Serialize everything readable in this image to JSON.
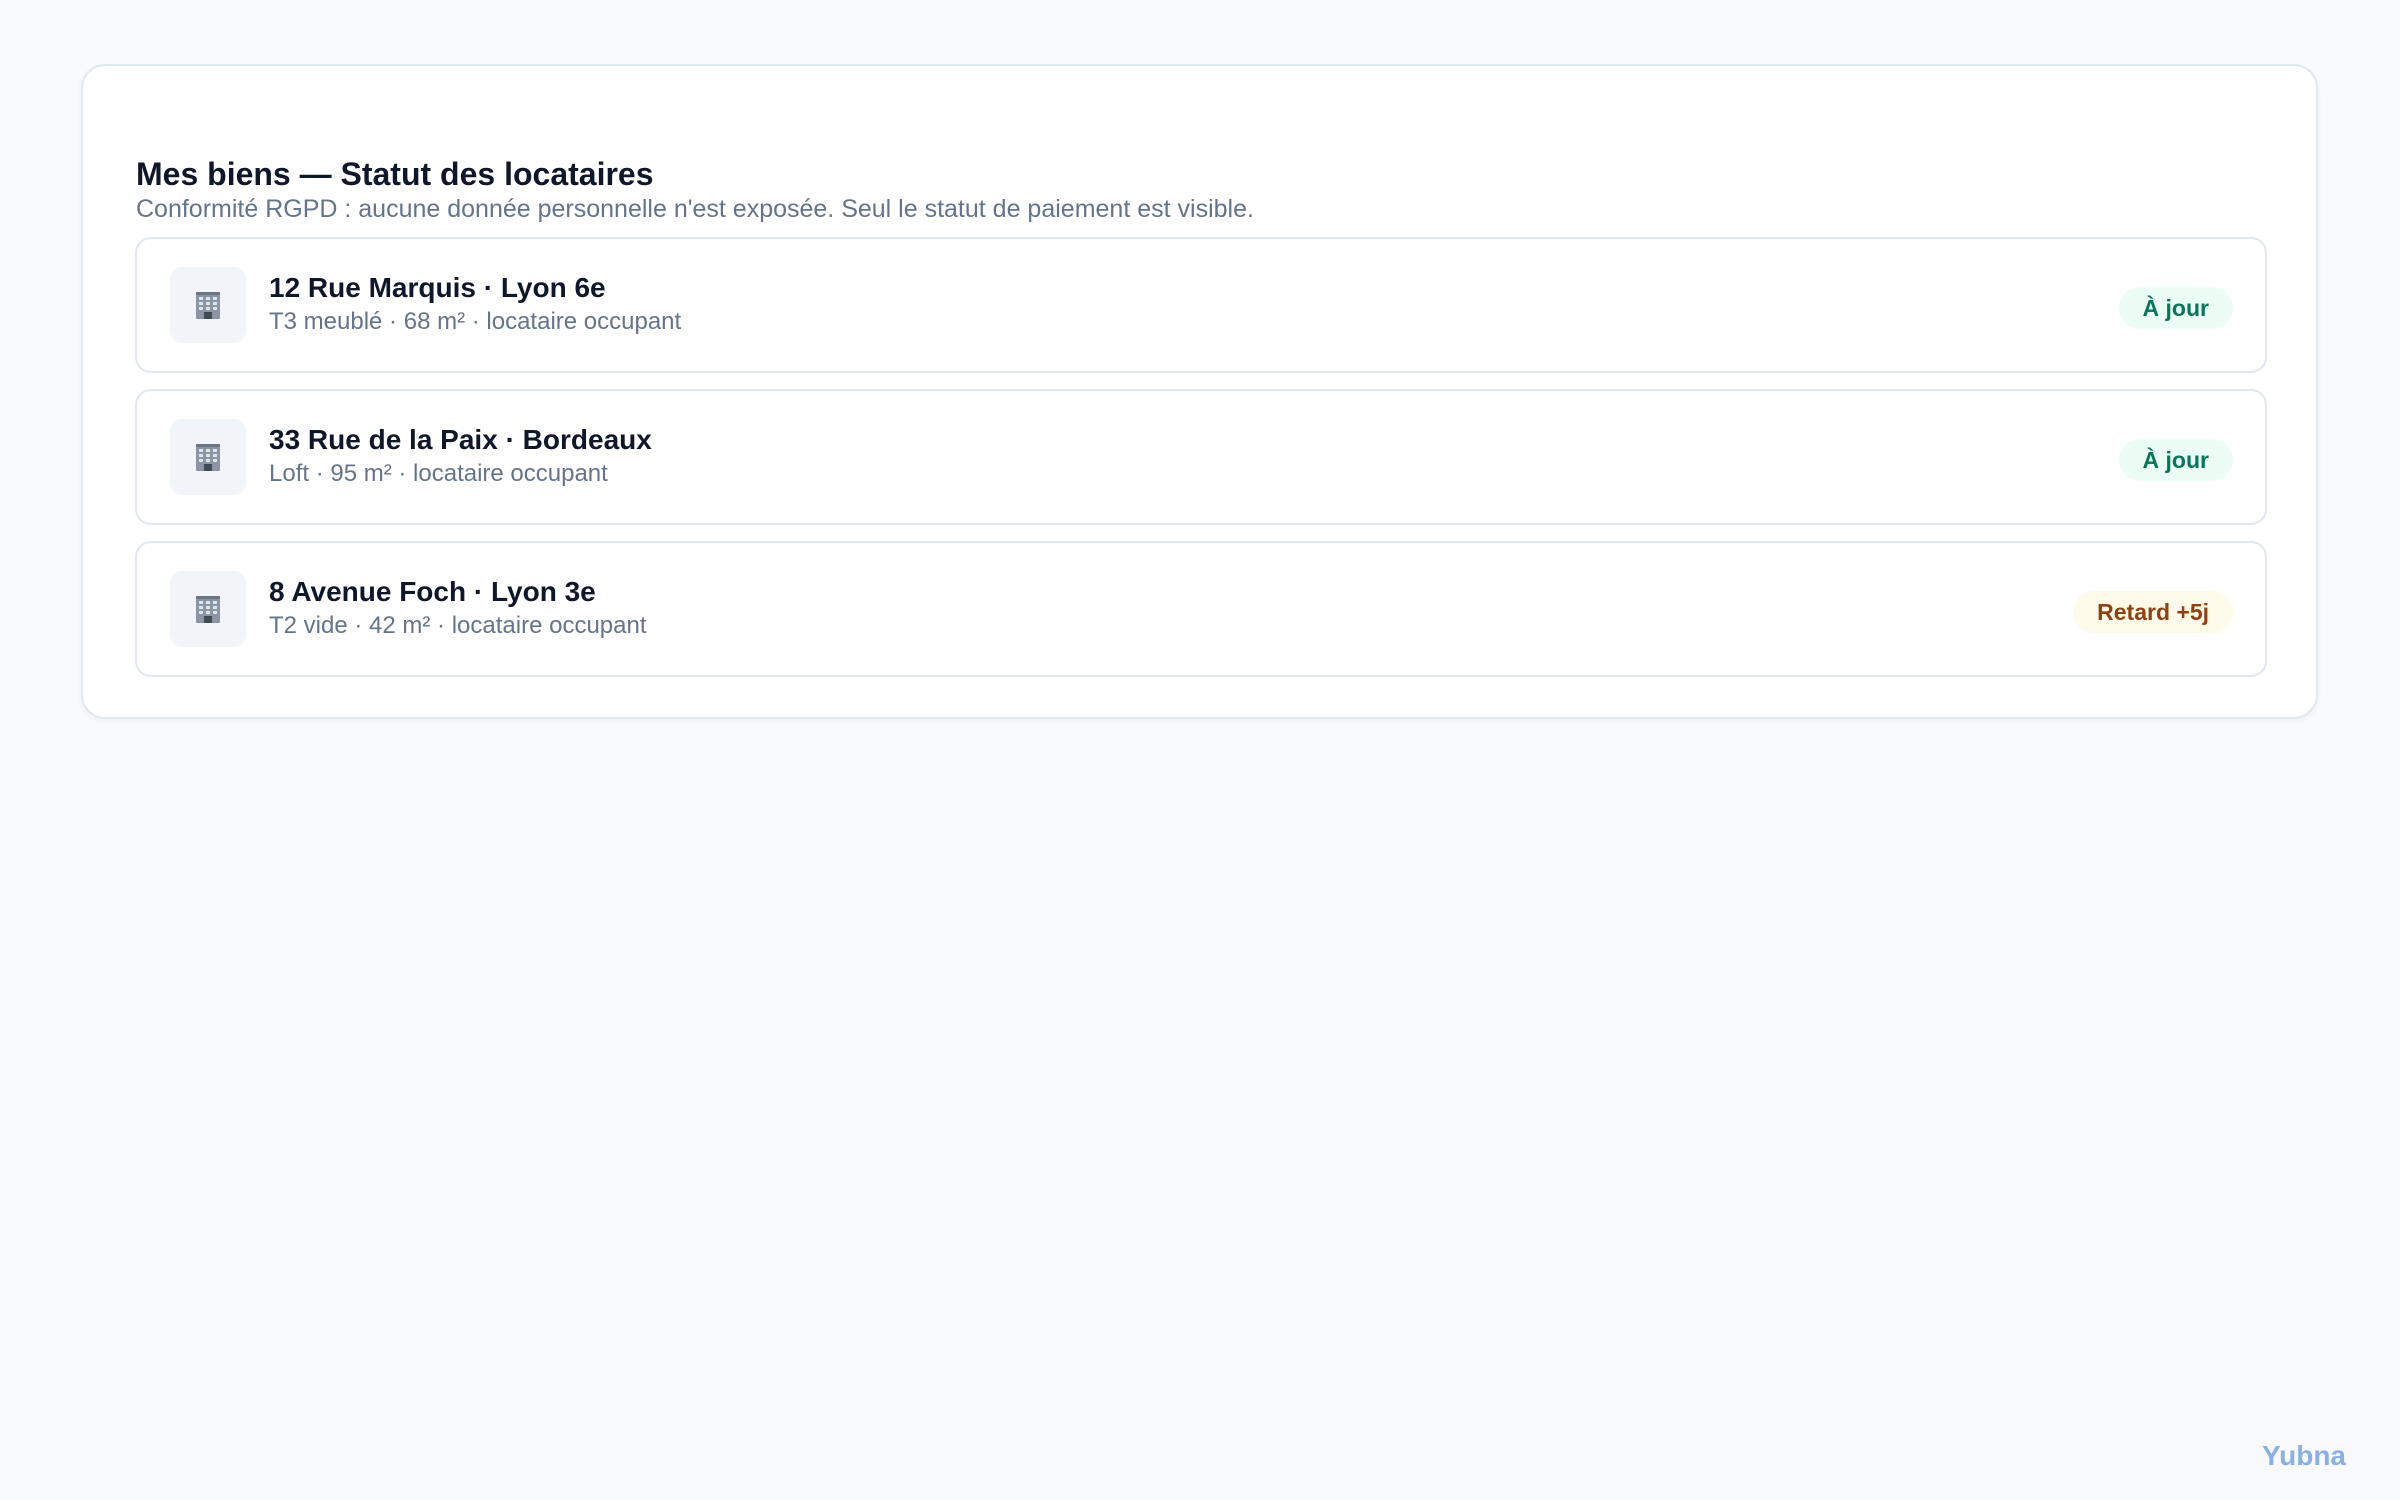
{
  "panel": {
    "title": "Mes biens — Statut des locataires",
    "subtitle": "Conformité RGPD : aucune donnée personnelle n'est exposée. Seul le statut de paiement est visible."
  },
  "properties": [
    {
      "icon": "building-icon",
      "address": "12 Rue Marquis · Lyon 6e",
      "meta": "T3 meublé · 68 m² · locataire occupant",
      "status": "À jour",
      "status_type": "ok"
    },
    {
      "icon": "building-icon",
      "address": "33 Rue de la Paix · Bordeaux",
      "meta": "Loft · 95 m² · locataire occupant",
      "status": "À jour",
      "status_type": "ok"
    },
    {
      "icon": "building-icon",
      "address": "8 Avenue Foch · Lyon 3e",
      "meta": "T2 vide · 42 m² · locataire occupant",
      "status": "Retard +5j",
      "status_type": "late"
    }
  ],
  "brand": "Yubna",
  "colors": {
    "ok_text": "#047857",
    "ok_bg": "#ecfdf5",
    "late_text": "#92400e",
    "late_bg": "#fffbeb",
    "brand": "#8ab0e8"
  }
}
